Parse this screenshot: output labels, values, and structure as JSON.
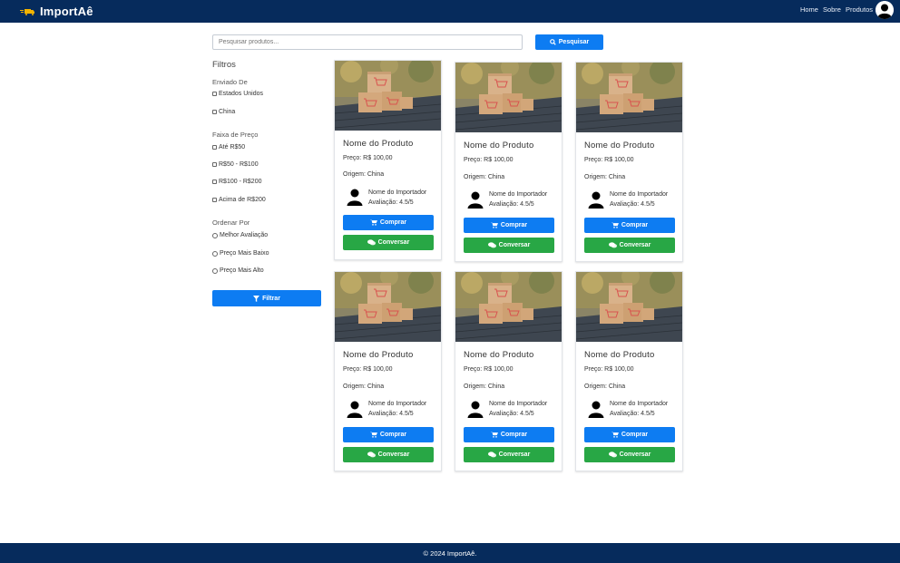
{
  "brand": {
    "name": "ImportAê"
  },
  "nav": {
    "items": [
      "Home",
      "Sobre",
      "Produtos"
    ]
  },
  "search": {
    "placeholder": "Pesquisar produtos...",
    "button_label": "Pesquisar"
  },
  "filters": {
    "title": "Filtros",
    "origin_label": "Enviado De",
    "origin_options": [
      "Estados Unidos",
      "China"
    ],
    "price_label": "Faixa de Preço",
    "price_options": [
      "Até R$50",
      "R$50 - R$100",
      "R$100 - R$200",
      "Acima de R$200"
    ],
    "sort_label": "Ordenar Por",
    "sort_options": [
      "Melhor Avaliação",
      "Preço Mais Baixo",
      "Preço Mais Alto"
    ],
    "button_label": "Filtrar"
  },
  "products": [
    {
      "title": "Nome do Produto",
      "price": "Preço: R$ 100,00",
      "origin": "Origem: China",
      "importer": "Nome do Importador",
      "rating": "Avaliação: 4.5/5",
      "buy_label": "Comprar",
      "chat_label": "Conversar"
    },
    {
      "title": "Nome do Produto",
      "price": "Preço: R$ 100,00",
      "origin": "Origem: China",
      "importer": "Nome do Importador",
      "rating": "Avaliação: 4.5/5",
      "buy_label": "Comprar",
      "chat_label": "Conversar"
    },
    {
      "title": "Nome do Produto",
      "price": "Preço: R$ 100,00",
      "origin": "Origem: China",
      "importer": "Nome do Importador",
      "rating": "Avaliação: 4.5/5",
      "buy_label": "Comprar",
      "chat_label": "Conversar"
    },
    {
      "title": "Nome do Produto",
      "price": "Preço: R$ 100,00",
      "origin": "Origem: China",
      "importer": "Nome do Importador",
      "rating": "Avaliação: 4.5/5",
      "buy_label": "Comprar",
      "chat_label": "Conversar"
    },
    {
      "title": "Nome do Produto",
      "price": "Preço: R$ 100,00",
      "origin": "Origem: China",
      "importer": "Nome do Importador",
      "rating": "Avaliação: 4.5/5",
      "buy_label": "Comprar",
      "chat_label": "Conversar"
    },
    {
      "title": "Nome do Produto",
      "price": "Preço: R$ 100,00",
      "origin": "Origem: China",
      "importer": "Nome do Importador",
      "rating": "Avaliação: 4.5/5",
      "buy_label": "Comprar",
      "chat_label": "Conversar"
    }
  ],
  "footer": {
    "text": "© 2024 ImportAê."
  },
  "colors": {
    "navbar": "#062b5c",
    "primary": "#0d7cf2",
    "success": "#28a745"
  }
}
